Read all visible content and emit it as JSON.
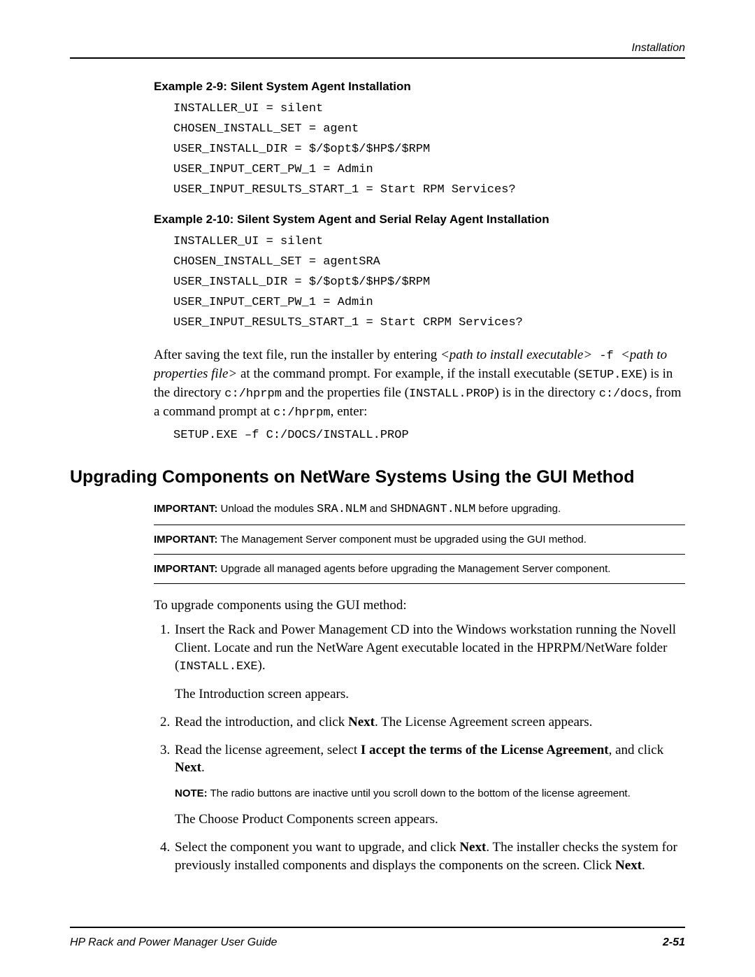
{
  "header": {
    "section": "Installation"
  },
  "example29": {
    "title": "Example 2-9:  Silent System Agent Installation",
    "code": "INSTALLER_UI = silent\nCHOSEN_INSTALL_SET = agent\nUSER_INSTALL_DIR = $/$opt$/$HP$/$RPM\nUSER_INPUT_CERT_PW_1 = Admin\nUSER_INPUT_RESULTS_START_1 = Start RPM Services?"
  },
  "example210": {
    "title": "Example 2-10:  Silent System Agent and Serial Relay Agent Installation",
    "code": "INSTALLER_UI = silent\nCHOSEN_INSTALL_SET = agentSRA\nUSER_INSTALL_DIR = $/$opt$/$HP$/$RPM\nUSER_INPUT_CERT_PW_1 = Admin\nUSER_INPUT_RESULTS_START_1 = Start CRPM Services?"
  },
  "afterSave": {
    "t1": "After saving the text file, run the installer by entering ",
    "ital1": "<path to install executable>",
    "mono_flag": " -f ",
    "ital2": " <path to properties file>",
    "t2": " at the command prompt. For example, if the install executable (",
    "mono1": "SETUP.EXE",
    "t3": ") is in the directory ",
    "mono2": "c:/hprpm",
    "t4": " and the properties file (",
    "mono3": "INSTALL.PROP",
    "t5": ") is in the directory ",
    "mono4": "c:/docs",
    "t6": ", from a command prompt at ",
    "mono5": "c:/hprpm",
    "t7": ", enter:"
  },
  "afterSaveCmd": "SETUP.EXE –f C:/DOCS/INSTALL.PROP",
  "sectionHeading": "Upgrading Components on NetWare Systems Using the GUI Method",
  "imp1": {
    "label": "IMPORTANT:",
    "pre": "  Unload the modules ",
    "m1": "SRA.NLM",
    "mid": " and ",
    "m2": "SHDNAGNT.NLM",
    "post": " before upgrading."
  },
  "imp2": {
    "label": "IMPORTANT:",
    "text": "  The Management Server component must be upgraded using the GUI method."
  },
  "imp3": {
    "label": "IMPORTANT:",
    "text": "  Upgrade all managed agents before upgrading the Management Server component."
  },
  "introLine": "To upgrade components using the GUI method:",
  "step1": {
    "a": "Insert the Rack and Power Management CD into the Windows workstation running the Novell Client. Locate and run the NetWare Agent executable located in the HPRPM/NetWare folder (",
    "m": "INSTALL.EXE",
    "b": ").",
    "sub": "The Introduction screen appears."
  },
  "step2": {
    "a": "Read the introduction, and click ",
    "bold": "Next",
    "b": ". The License Agreement screen appears."
  },
  "step3": {
    "a": "Read the license agreement, select ",
    "bold1": "I accept the terms of the License Agreement",
    "mid": ", and click ",
    "bold2": "Next",
    "end": ".",
    "note_label": "NOTE:",
    "note_text": "  The radio buttons are inactive until you scroll down to the bottom of the license agreement.",
    "sub": "The Choose Product Components screen appears."
  },
  "step4": {
    "a": "Select the component you want to upgrade, and click ",
    "bold1": "Next",
    "mid": ". The installer checks the system for previously installed components and displays the components on the screen. Click ",
    "bold2": "Next",
    "end": "."
  },
  "footer": {
    "left": "HP Rack and Power Manager User Guide",
    "right": "2-51"
  }
}
